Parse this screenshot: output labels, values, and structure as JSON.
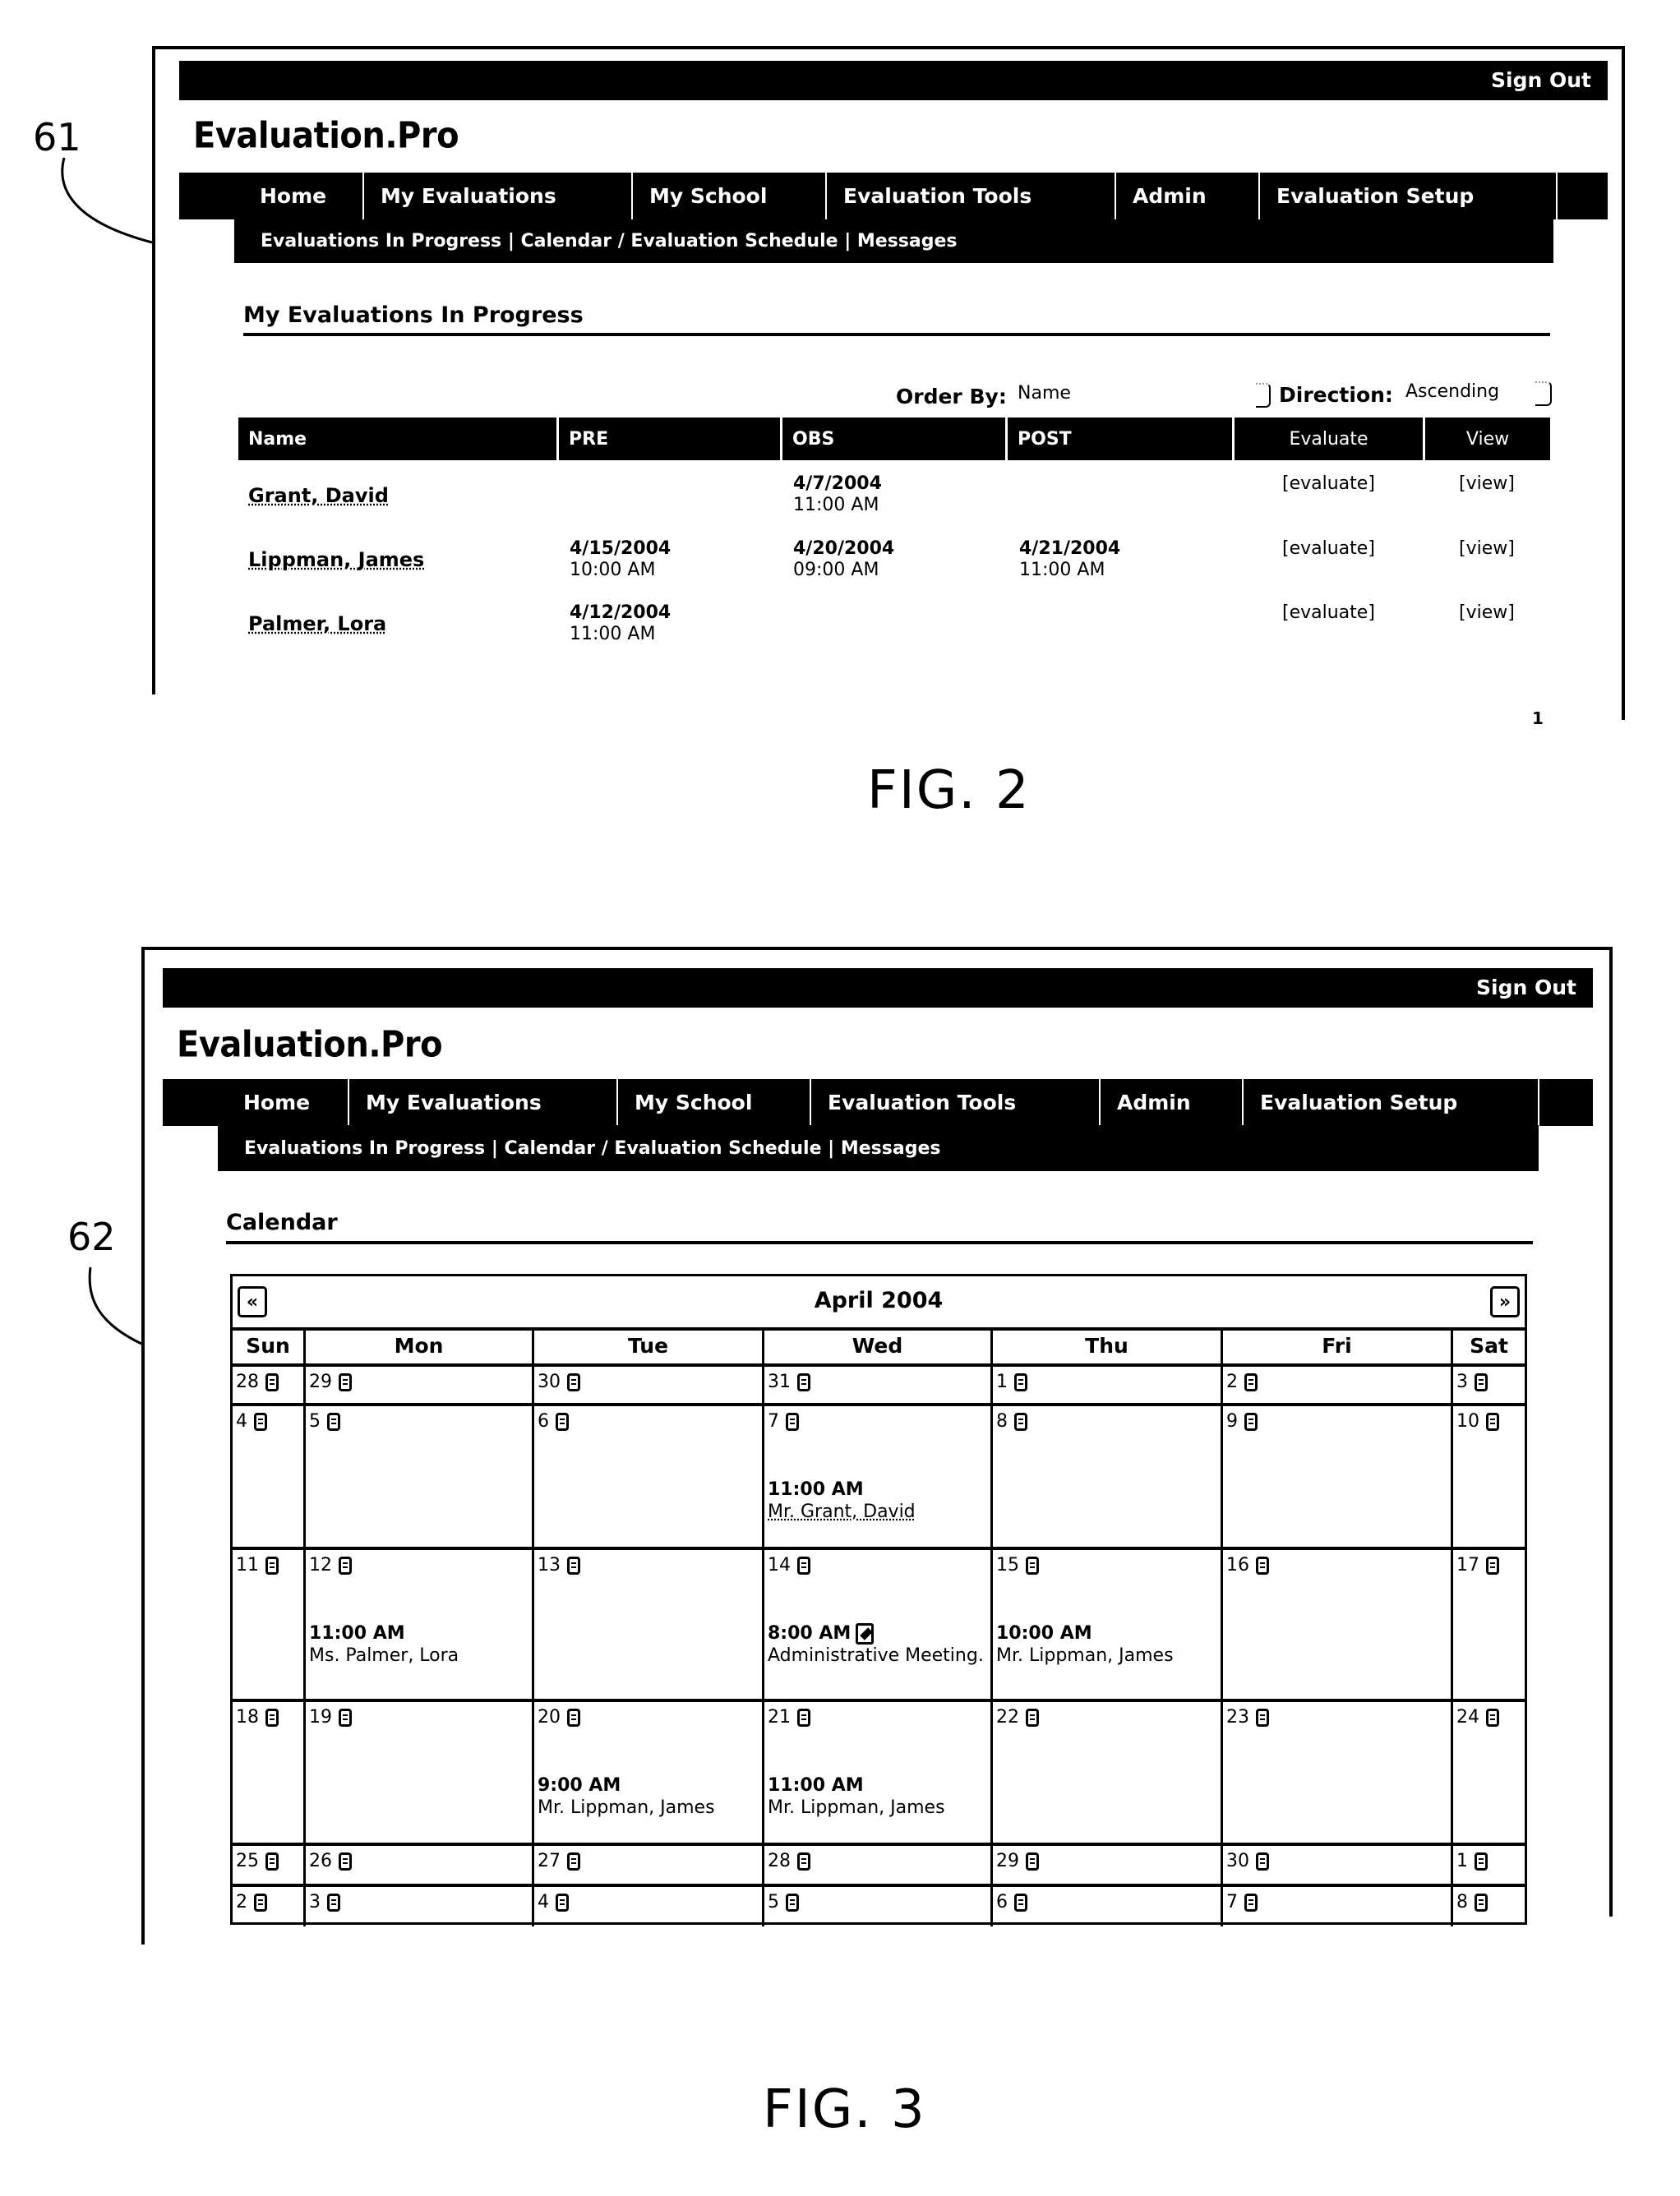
{
  "fig2": {
    "ref_number": "61",
    "fig_label": "FIG. 2",
    "page_number": "1",
    "app": {
      "sign_out": "Sign Out",
      "logo": "Evaluation.Pro",
      "nav": [
        "Home",
        "My Evaluations",
        "My School",
        "Evaluation Tools",
        "Admin",
        "Evaluation Setup"
      ],
      "subnav": [
        "Evaluations In Progress",
        "Calendar / Evaluation Schedule",
        "Messages"
      ],
      "subnav_separator": " | "
    },
    "section_title": "My Evaluations In Progress",
    "controls": {
      "order_by_label": "Order By:",
      "order_by_value": "Name",
      "direction_label": "Direction:",
      "direction_value": "Ascending"
    },
    "table": {
      "columns": [
        "Name",
        "PRE",
        "OBS",
        "POST",
        "Evaluate",
        "View"
      ],
      "rows": [
        {
          "name": "Grant, David",
          "pre": {
            "date": "",
            "time": ""
          },
          "obs": {
            "date": "4/7/2004",
            "time": "11:00 AM"
          },
          "post": {
            "date": "",
            "time": ""
          },
          "evaluate": "[evaluate]",
          "view": "[view]"
        },
        {
          "name": "Lippman, James",
          "pre": {
            "date": "4/15/2004",
            "time": "10:00 AM"
          },
          "obs": {
            "date": "4/20/2004",
            "time": "09:00 AM"
          },
          "post": {
            "date": "4/21/2004",
            "time": "11:00 AM"
          },
          "evaluate": "[evaluate]",
          "view": "[view]"
        },
        {
          "name": "Palmer, Lora",
          "pre": {
            "date": "4/12/2004",
            "time": "11:00 AM"
          },
          "obs": {
            "date": "",
            "time": ""
          },
          "post": {
            "date": "",
            "time": ""
          },
          "evaluate": "[evaluate]",
          "view": "[view]"
        }
      ]
    }
  },
  "fig3": {
    "ref_number": "62",
    "fig_label": "FIG. 3",
    "app": {
      "sign_out": "Sign Out",
      "logo": "Evaluation.Pro",
      "nav": [
        "Home",
        "My Evaluations",
        "My School",
        "Evaluation Tools",
        "Admin",
        "Evaluation Setup"
      ],
      "subnav": [
        "Evaluations In Progress",
        "Calendar",
        "Evaluation Schedule",
        "Messages"
      ],
      "subnav_text": "Evaluations In Progress | Calendar / Evaluation Schedule | Messages"
    },
    "section_title": "Calendar",
    "calendar": {
      "month_title": "April 2004",
      "prev_label": "«",
      "next_label": "»",
      "weekdays": [
        "Sun",
        "Mon",
        "Tue",
        "Wed",
        "Thu",
        "Fri",
        "Sat"
      ],
      "weeks": [
        [
          {
            "day": "28"
          },
          {
            "day": "29"
          },
          {
            "day": "30"
          },
          {
            "day": "31"
          },
          {
            "day": "1"
          },
          {
            "day": "2"
          },
          {
            "day": "3"
          }
        ],
        [
          {
            "day": "4"
          },
          {
            "day": "5"
          },
          {
            "day": "6"
          },
          {
            "day": "7",
            "event": {
              "time": "11:00 AM",
              "text": "Mr. Grant, David"
            }
          },
          {
            "day": "8"
          },
          {
            "day": "9"
          },
          {
            "day": "10"
          }
        ],
        [
          {
            "day": "11"
          },
          {
            "day": "12",
            "event": {
              "time": "11:00 AM",
              "text": "Ms. Palmer, Lora"
            }
          },
          {
            "day": "13"
          },
          {
            "day": "14",
            "event": {
              "time": "8:00 AM",
              "text": "Administrative Meeting.",
              "editable": true
            }
          },
          {
            "day": "15",
            "event": {
              "time": "10:00 AM",
              "text": "Mr. Lippman, James"
            }
          },
          {
            "day": "16"
          },
          {
            "day": "17"
          }
        ],
        [
          {
            "day": "18"
          },
          {
            "day": "19"
          },
          {
            "day": "20",
            "event": {
              "time": "9:00 AM",
              "text": "Mr. Lippman, James"
            }
          },
          {
            "day": "21",
            "event": {
              "time": "11:00 AM",
              "text": "Mr. Lippman, James"
            }
          },
          {
            "day": "22"
          },
          {
            "day": "23"
          },
          {
            "day": "24"
          }
        ],
        [
          {
            "day": "25"
          },
          {
            "day": "26"
          },
          {
            "day": "27"
          },
          {
            "day": "28"
          },
          {
            "day": "29"
          },
          {
            "day": "30"
          },
          {
            "day": "1"
          }
        ],
        [
          {
            "day": "2"
          },
          {
            "day": "3"
          },
          {
            "day": "4"
          },
          {
            "day": "5"
          },
          {
            "day": "6"
          },
          {
            "day": "7"
          },
          {
            "day": "8"
          }
        ]
      ],
      "day_icon": "calendar-page-icon",
      "edit_icon": "edit-note-icon"
    }
  }
}
